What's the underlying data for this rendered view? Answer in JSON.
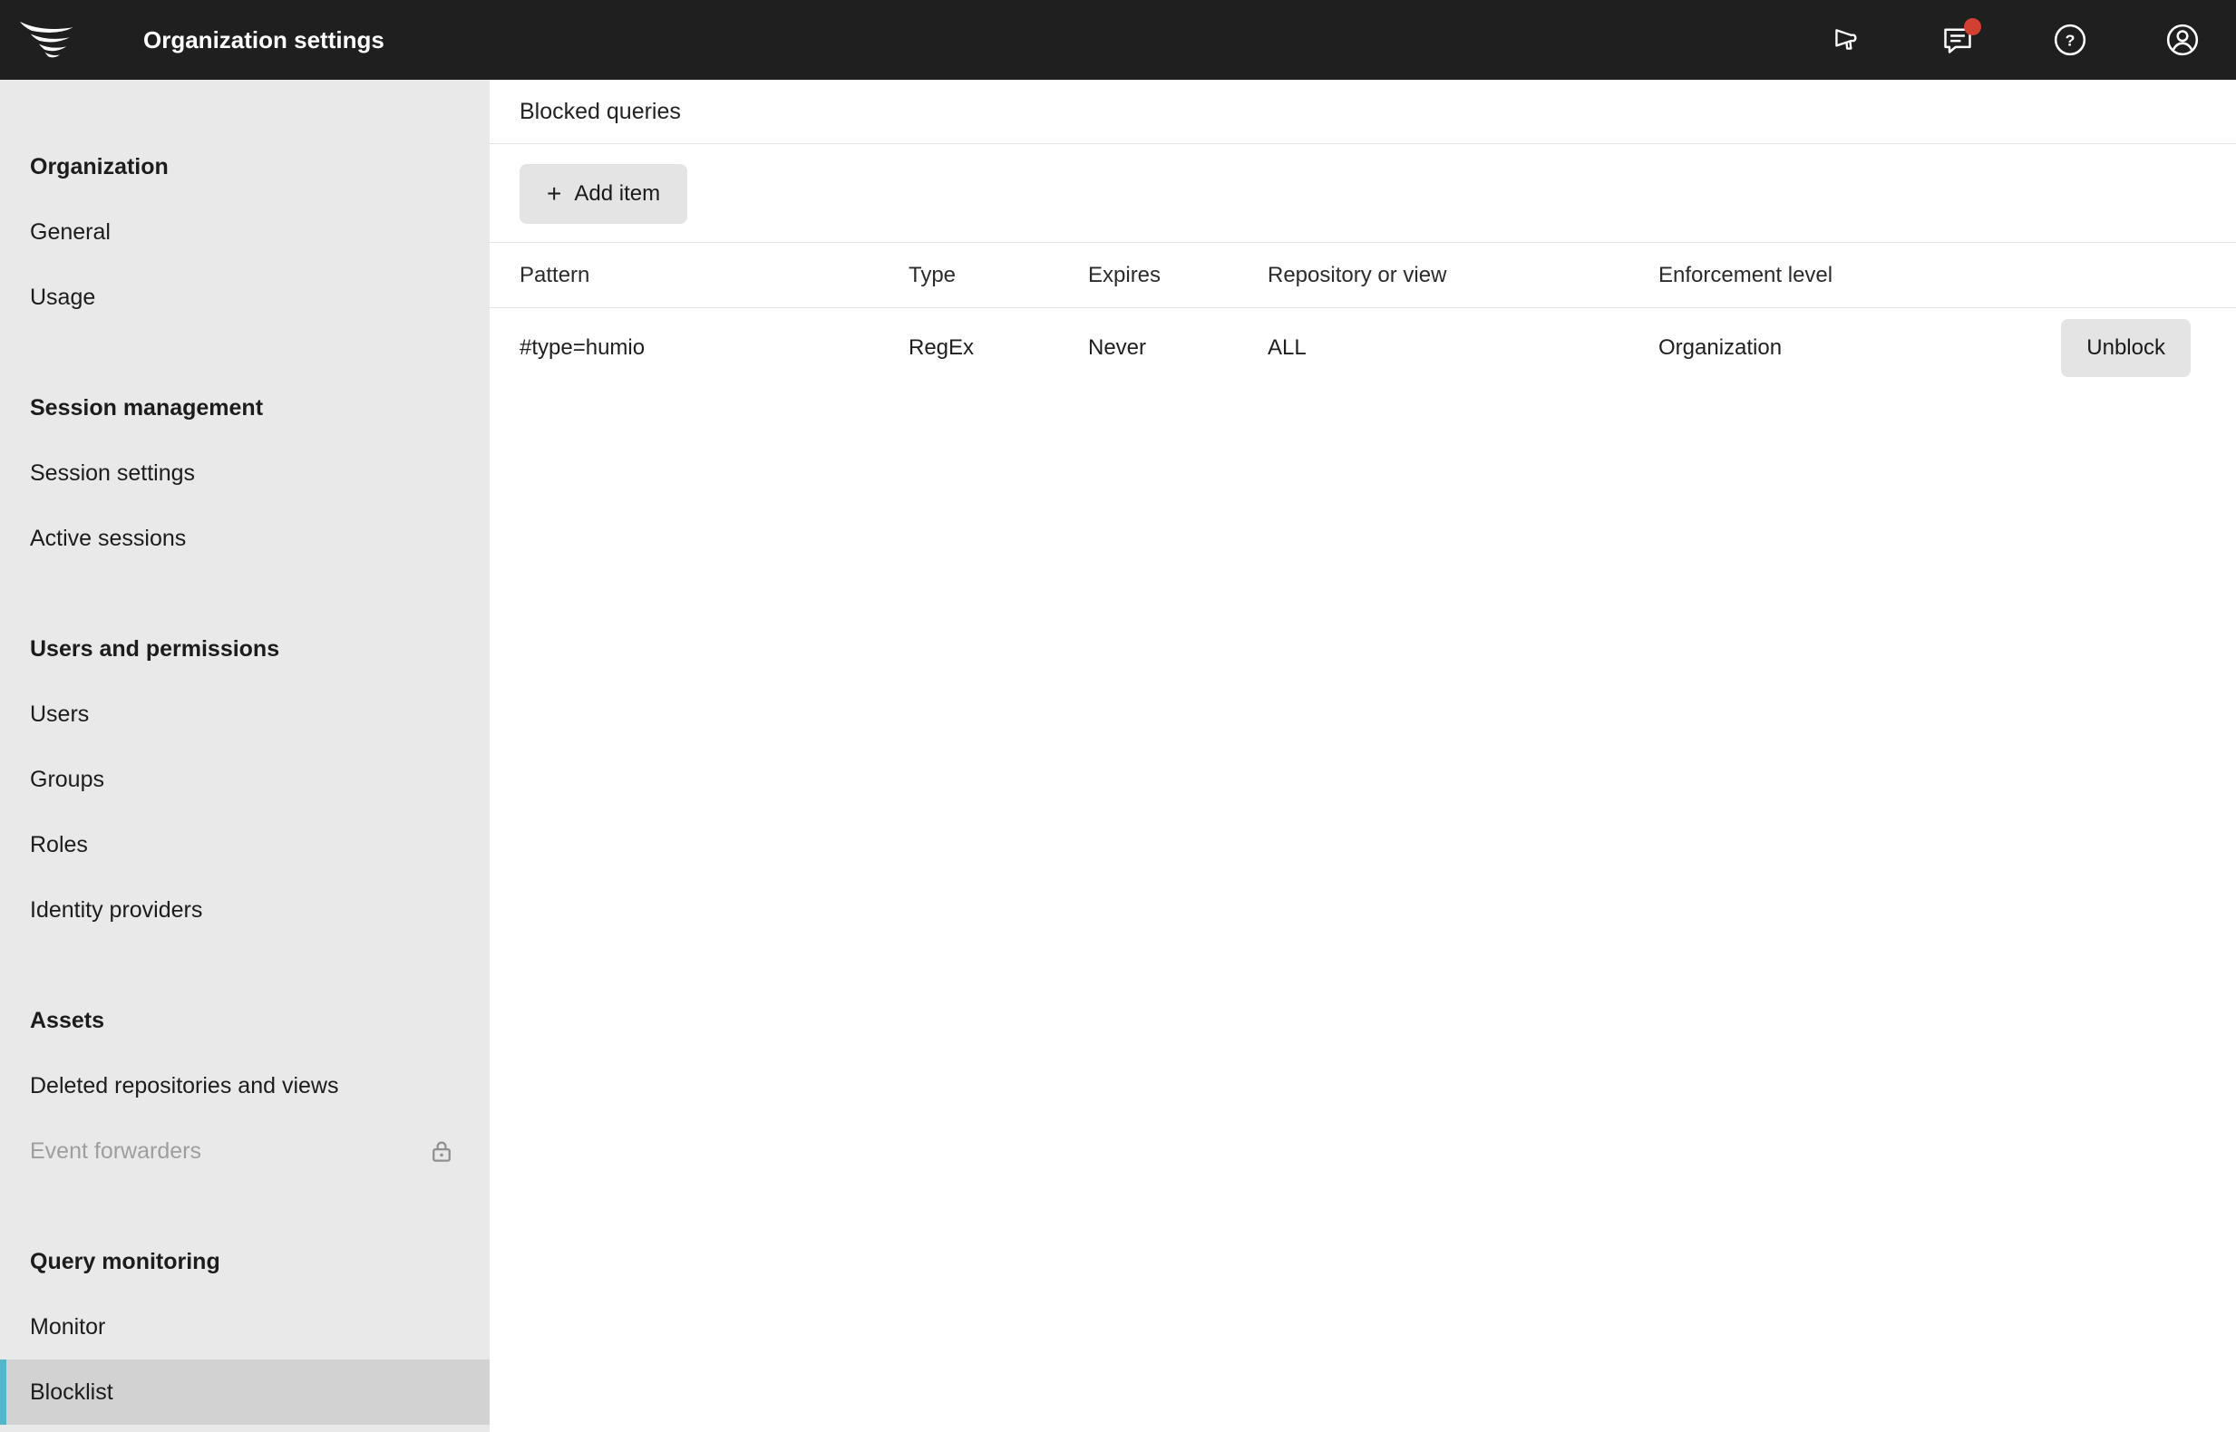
{
  "topbar": {
    "title": "Organization settings",
    "icons": [
      "announcements-icon",
      "messages-icon",
      "help-icon",
      "profile-icon"
    ]
  },
  "sidebar": {
    "sections": [
      {
        "heading": "Organization",
        "items": [
          {
            "label": "General"
          },
          {
            "label": "Usage"
          }
        ]
      },
      {
        "heading": "Session management",
        "items": [
          {
            "label": "Session settings"
          },
          {
            "label": "Active sessions"
          }
        ]
      },
      {
        "heading": "Users and permissions",
        "items": [
          {
            "label": "Users"
          },
          {
            "label": "Groups"
          },
          {
            "label": "Roles"
          },
          {
            "label": "Identity providers"
          }
        ]
      },
      {
        "heading": "Assets",
        "items": [
          {
            "label": "Deleted repositories and views"
          },
          {
            "label": "Event forwarders",
            "locked": true
          }
        ]
      },
      {
        "heading": "Query monitoring",
        "items": [
          {
            "label": "Monitor"
          },
          {
            "label": "Blocklist",
            "selected": true
          }
        ]
      }
    ]
  },
  "main": {
    "title": "Blocked queries",
    "add_button": "Add item",
    "table": {
      "headers": [
        "Pattern",
        "Type",
        "Expires",
        "Repository or view",
        "Enforcement level"
      ],
      "rows": [
        {
          "pattern": "#type=humio",
          "type": "RegEx",
          "expires": "Never",
          "repository": "ALL",
          "enforcement": "Organization",
          "action": "Unblock"
        }
      ]
    }
  },
  "colors": {
    "accent": "#53b7cc",
    "notification": "#d43f33",
    "topbar_bg": "#1f1f1f",
    "sidebar_bg": "#e9e9e9",
    "selected_bg": "#d2d2d2"
  }
}
